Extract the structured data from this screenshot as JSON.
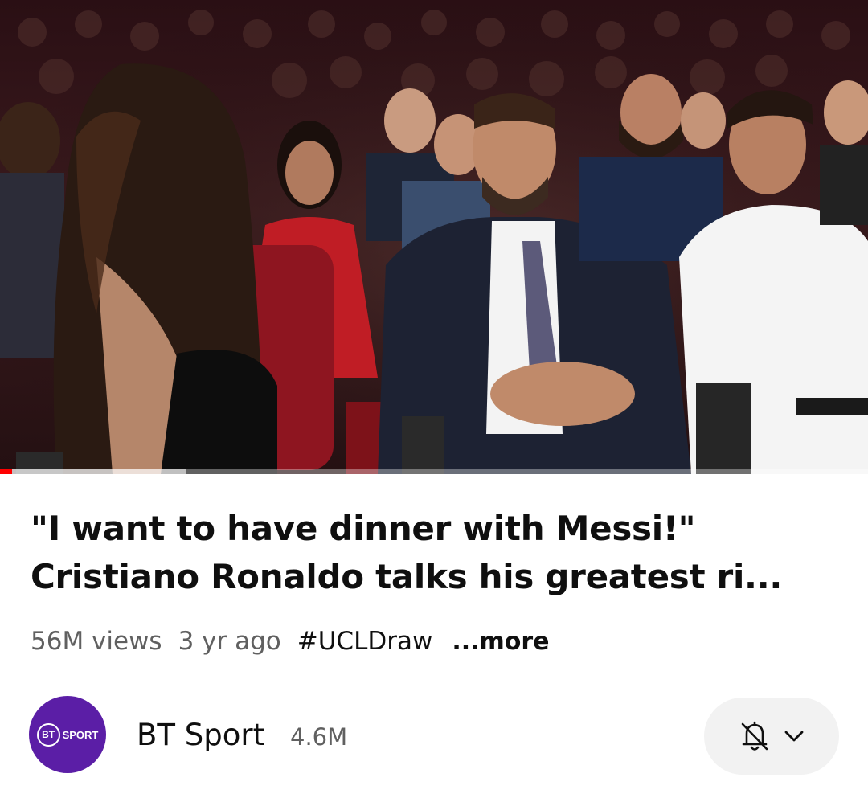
{
  "player": {
    "progress_played": 0.014,
    "progress_buffered": 0.215,
    "colors": {
      "played": "#ff0000",
      "track": "#b5b5b5"
    }
  },
  "video": {
    "title_line1": "\"I want to have dinner with Messi!\"",
    "title_line2": "Cristiano Ronaldo talks his greatest ri...",
    "views": "56M views",
    "age": "3 yr ago",
    "hashtag": "#UCLDraw",
    "more_label": "...more"
  },
  "channel": {
    "logo_bt": "BT",
    "logo_sport": "SPORT",
    "name": "BT Sport",
    "subscribers": "4.6M",
    "avatar_color": "#5b1ea6",
    "notification_icon": "bell-off-icon",
    "dropdown_icon": "chevron-down-icon"
  }
}
